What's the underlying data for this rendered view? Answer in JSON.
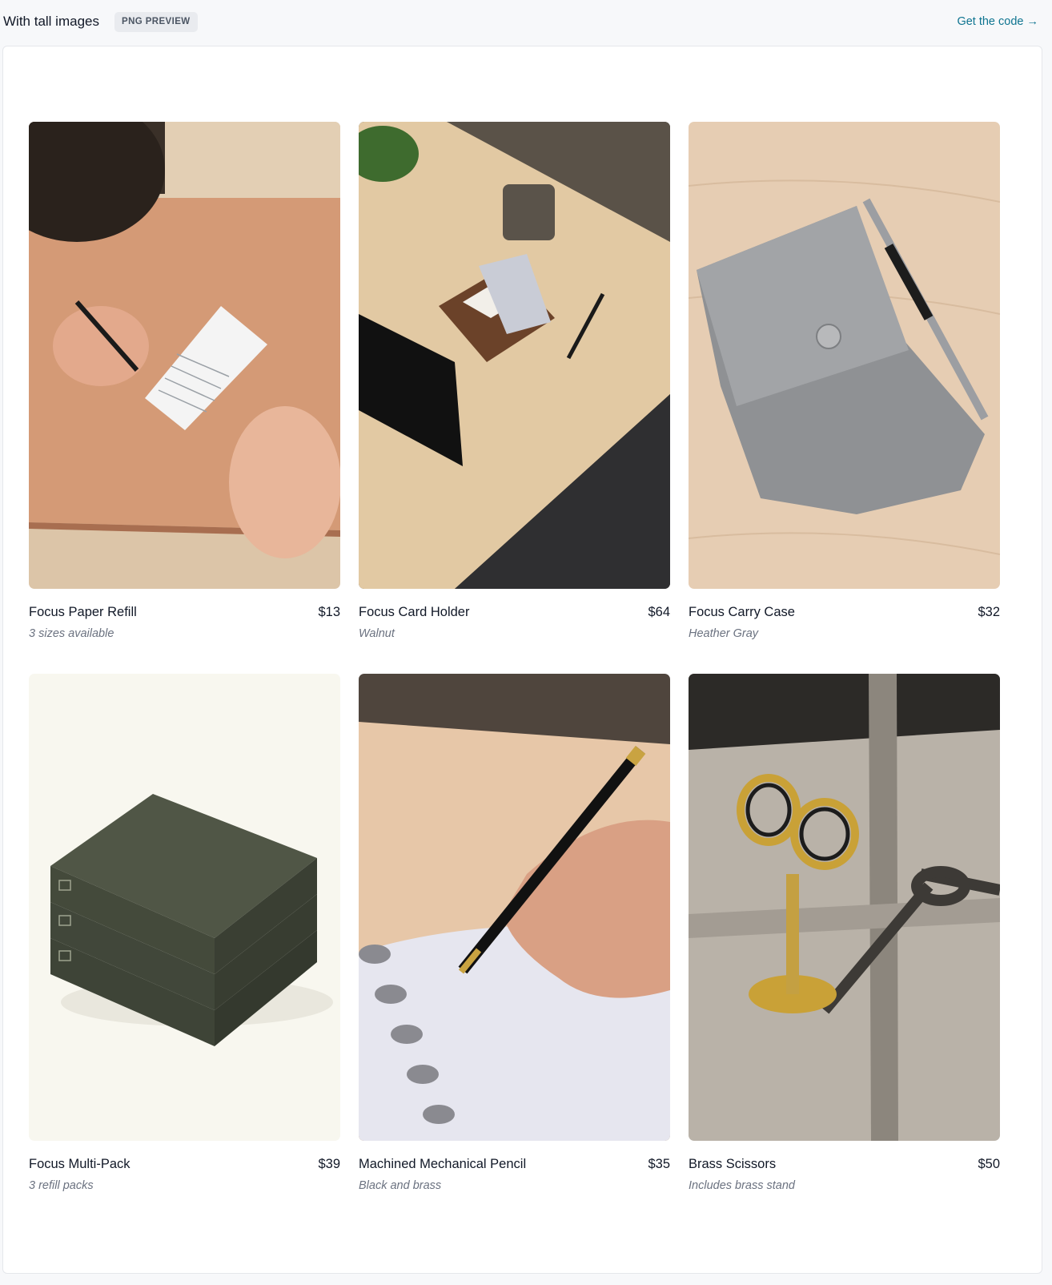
{
  "header": {
    "title": "With tall images",
    "badge": "PNG PREVIEW",
    "code_link": "Get the code →"
  },
  "products": [
    {
      "name": "Focus Paper Refill",
      "price": "$13",
      "detail": "3 sizes available",
      "image": "hand-writing-on-card-photo"
    },
    {
      "name": "Focus Card Holder",
      "price": "$64",
      "detail": "Walnut",
      "image": "desk-card-holder-photo"
    },
    {
      "name": "Focus Carry Case",
      "price": "$32",
      "detail": "Heather Gray",
      "image": "felt-case-photo"
    },
    {
      "name": "Focus Multi-Pack",
      "price": "$39",
      "detail": "3 refill packs",
      "image": "stacked-boxes-photo"
    },
    {
      "name": "Machined Mechanical Pencil",
      "price": "$35",
      "detail": "Black and brass",
      "image": "pencil-notebook-photo"
    },
    {
      "name": "Brass Scissors",
      "price": "$50",
      "detail": "Includes brass stand",
      "image": "brass-scissors-photo"
    }
  ],
  "colors": {
    "accent_link": "#0e7490",
    "muted_text": "#6b7280",
    "panel_bg": "#ffffff",
    "page_bg": "#f7f8fa"
  }
}
